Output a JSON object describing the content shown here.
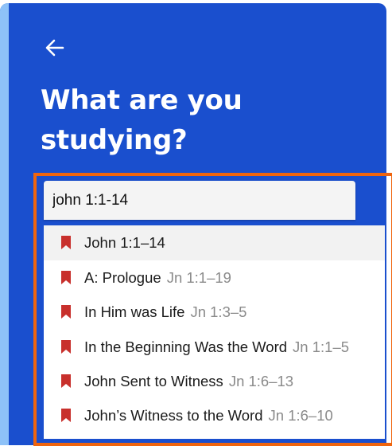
{
  "header": {
    "back_icon": "arrow-left-icon",
    "title": "What are you studying?"
  },
  "search": {
    "value": "john 1:1-14"
  },
  "colors": {
    "panel": "#1a4fce",
    "highlight_border": "#f0650e",
    "bookmark": "#c8302c"
  },
  "suggestions": [
    {
      "label": "John 1:1–14",
      "ref": "",
      "icon": "bookmark-icon"
    },
    {
      "label": "A: Prologue",
      "ref": "Jn 1:1–19",
      "icon": "bookmark-icon"
    },
    {
      "label": "In Him was Life",
      "ref": "Jn 1:3–5",
      "icon": "bookmark-icon"
    },
    {
      "label": "In the Beginning Was the Word",
      "ref": "Jn 1:1–5",
      "icon": "bookmark-icon"
    },
    {
      "label": "John Sent to Witness",
      "ref": "Jn 1:6–13",
      "icon": "bookmark-icon"
    },
    {
      "label": "John’s Witness to the Word",
      "ref": "Jn 1:6–10",
      "icon": "bookmark-icon"
    }
  ]
}
